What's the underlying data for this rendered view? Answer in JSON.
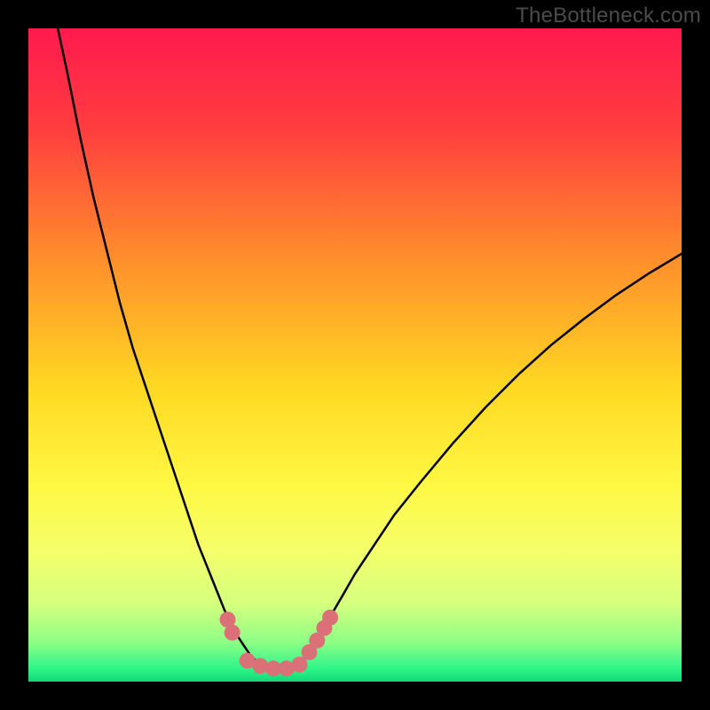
{
  "watermark": "TheBottleneck.com",
  "chart_data": {
    "type": "line",
    "title": "",
    "xlabel": "",
    "ylabel": "",
    "xlim": [
      0,
      100
    ],
    "ylim": [
      0,
      100
    ],
    "background_gradient": {
      "stops": [
        {
          "offset": 0.0,
          "color": "#ff1a4e"
        },
        {
          "offset": 0.15,
          "color": "#ff3c3f"
        },
        {
          "offset": 0.35,
          "color": "#ff8d2c"
        },
        {
          "offset": 0.55,
          "color": "#ffd822"
        },
        {
          "offset": 0.7,
          "color": "#fff844"
        },
        {
          "offset": 0.8,
          "color": "#f4ff6a"
        },
        {
          "offset": 0.88,
          "color": "#d6ff7e"
        },
        {
          "offset": 0.94,
          "color": "#8dff86"
        },
        {
          "offset": 0.98,
          "color": "#30f588"
        },
        {
          "offset": 1.0,
          "color": "#10d877"
        }
      ]
    },
    "series": [
      {
        "name": "left-curve",
        "color": "#000000",
        "width": 2.5,
        "x": [
          4.5,
          6,
          8,
          10,
          12,
          14,
          16,
          18,
          20,
          22,
          24,
          26,
          27,
          28,
          29,
          30,
          31,
          32,
          33,
          34,
          35,
          36
        ],
        "y": [
          100,
          93,
          83,
          74,
          66,
          58,
          51,
          45,
          39,
          33,
          27,
          21,
          18.5,
          16,
          13.5,
          11,
          9,
          7,
          5.5,
          4,
          3,
          2.2
        ]
      },
      {
        "name": "right-curve",
        "color": "#000000",
        "width": 2.5,
        "x": [
          41,
          42,
          43,
          44,
          45,
          46,
          48,
          50,
          53,
          56,
          60,
          65,
          70,
          75,
          80,
          85,
          90,
          95,
          100
        ],
        "y": [
          2.2,
          3.2,
          4.5,
          6.0,
          7.8,
          9.6,
          13.0,
          16.5,
          21.0,
          25.5,
          30.5,
          36.5,
          42.0,
          47.0,
          51.5,
          55.5,
          59.2,
          62.5,
          65.5
        ]
      }
    ],
    "pink_clusters": [
      {
        "name": "left-cluster",
        "color": "#db7078",
        "radius": 9,
        "points": [
          {
            "x": 30.5,
            "y": 9.5
          },
          {
            "x": 31.2,
            "y": 7.5
          }
        ]
      },
      {
        "name": "bottom-cluster",
        "color": "#db7078",
        "radius": 9,
        "points": [
          {
            "x": 33.5,
            "y": 3.2
          },
          {
            "x": 35.5,
            "y": 2.4
          },
          {
            "x": 37.5,
            "y": 2.0
          },
          {
            "x": 39.5,
            "y": 2.0
          },
          {
            "x": 41.5,
            "y": 2.6
          }
        ]
      },
      {
        "name": "right-cluster",
        "color": "#db7078",
        "radius": 9,
        "points": [
          {
            "x": 43.0,
            "y": 4.5
          },
          {
            "x": 44.2,
            "y": 6.3
          },
          {
            "x": 45.3,
            "y": 8.2
          },
          {
            "x": 46.2,
            "y": 9.8
          }
        ]
      }
    ]
  }
}
